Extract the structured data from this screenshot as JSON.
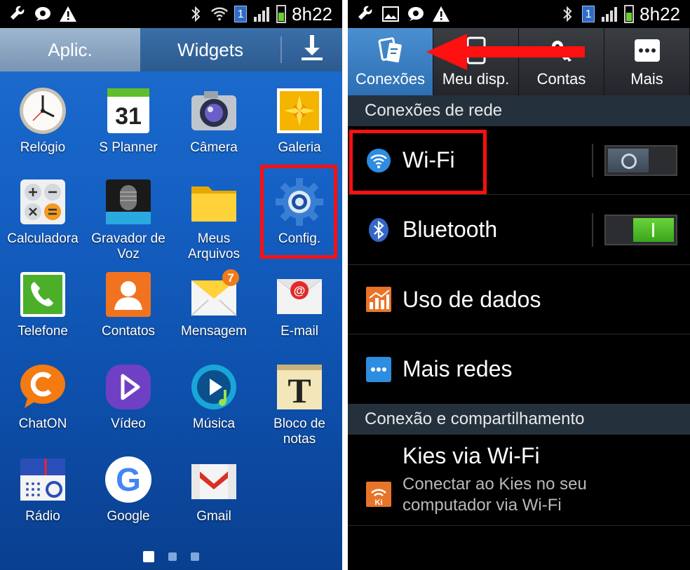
{
  "left_screen": {
    "status_time": "8h22",
    "status_badge": "1",
    "tabs": {
      "apps": "Aplic.",
      "widgets": "Widgets"
    },
    "apps": [
      {
        "label": "Relógio",
        "icon": "clock-icon"
      },
      {
        "label": "S Planner",
        "icon": "calendar-icon",
        "badge": "31"
      },
      {
        "label": "Câmera",
        "icon": "camera-icon"
      },
      {
        "label": "Galeria",
        "icon": "gallery-icon"
      },
      {
        "label": "Calculadora",
        "icon": "calculator-icon"
      },
      {
        "label": "Gravador de Voz",
        "icon": "microphone-icon"
      },
      {
        "label": "Meus Arquivos",
        "icon": "folder-icon"
      },
      {
        "label": "Config.",
        "icon": "gear-icon"
      },
      {
        "label": "Telefone",
        "icon": "phone-icon"
      },
      {
        "label": "Contatos",
        "icon": "contacts-icon"
      },
      {
        "label": "Mensagem",
        "icon": "message-icon",
        "badge": "7"
      },
      {
        "label": "E-mail",
        "icon": "email-icon"
      },
      {
        "label": "ChatON",
        "icon": "chaton-icon"
      },
      {
        "label": "Vídeo",
        "icon": "video-icon"
      },
      {
        "label": "Música",
        "icon": "music-icon"
      },
      {
        "label": "Bloco de notas",
        "icon": "notes-icon",
        "glyph": "T"
      },
      {
        "label": "Rádio",
        "icon": "radio-icon"
      },
      {
        "label": "Google",
        "icon": "google-icon",
        "glyph": "G"
      },
      {
        "label": "Gmail",
        "icon": "gmail-icon",
        "glyph": "M"
      }
    ],
    "page_dots": 3,
    "active_page": 0
  },
  "right_screen": {
    "status_time": "8h22",
    "status_badge": "1",
    "tabs": [
      {
        "label": "Conexões",
        "icon": "connections-icon",
        "active": true
      },
      {
        "label": "Meu disp.",
        "icon": "device-icon",
        "active": false
      },
      {
        "label": "Contas",
        "icon": "accounts-icon",
        "active": false
      },
      {
        "label": "Mais",
        "icon": "more-icon",
        "active": false
      }
    ],
    "section1": "Conexões de rede",
    "wifi": {
      "label": "Wi-Fi",
      "enabled": false
    },
    "bluetooth": {
      "label": "Bluetooth",
      "enabled": true
    },
    "data_usage": "Uso de dados",
    "more_networks": "Mais redes",
    "section2": "Conexão e compartilhamento",
    "kies": {
      "title": "Kies via Wi-Fi",
      "line1": "Conectar ao Kies no seu",
      "line2": "computador via Wi-Fi"
    }
  },
  "colors": {
    "highlight": "#ff1010",
    "accent_blue": "#2c6fb3",
    "toggle_on": "#3aa51c"
  }
}
